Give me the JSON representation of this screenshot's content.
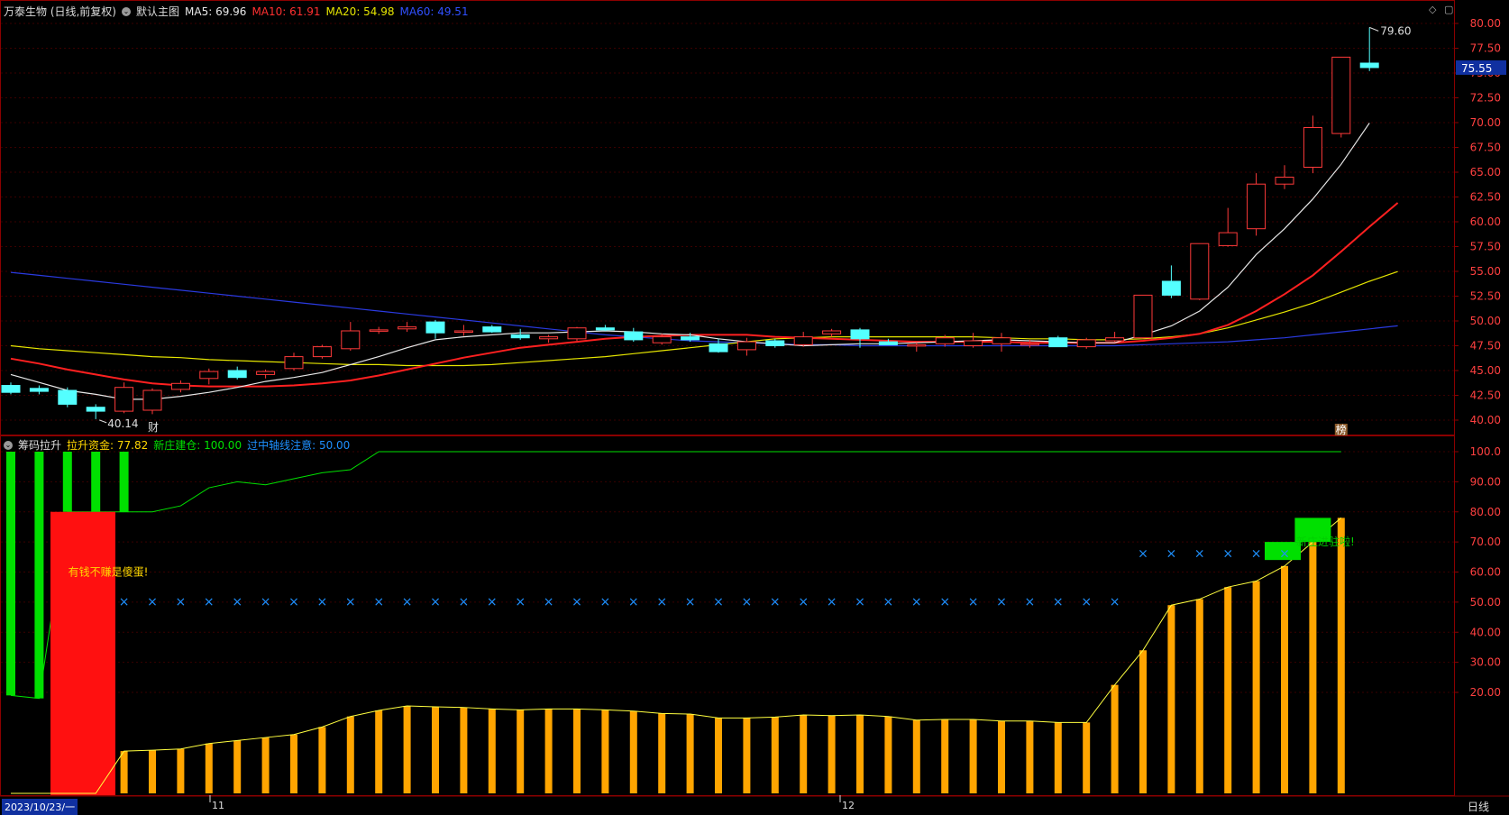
{
  "main_header": {
    "stock": "万泰生物 (日线,前复权)",
    "template": "默认主图",
    "ma5": "MA5: 69.96",
    "ma10": "MA10: 61.91",
    "ma20": "MA20: 54.98",
    "ma60": "MA60: 49.51"
  },
  "sub_header": {
    "indicator": "筹码拉升",
    "lift_fund": "拉升资金: 77.82",
    "new_dealer": "新庄建仓: 100.00",
    "midline": "过中轴线注意: 50.00"
  },
  "colors": {
    "up": "#ff3a3a",
    "down": "#54ffff",
    "ma5": "#e8e8e8",
    "ma10": "#ff2020",
    "ma20": "#e6e600",
    "ma60": "#2a3ae0",
    "frame": "#8b0000",
    "green": "#00e000",
    "orange": "#ffa500",
    "cross": "#1e90ff"
  },
  "current_price": "75.55",
  "high_label": "79.60",
  "low_label": "40.14",
  "markers": {
    "cai": "财",
    "bang": "榜"
  },
  "annotations": {
    "money": "有钱不赚是傻蛋!",
    "dealer": "新庄进驻啦!"
  },
  "price_axis": [
    "80.00",
    "77.50",
    "75.00",
    "72.50",
    "70.00",
    "67.50",
    "65.00",
    "62.50",
    "60.00",
    "57.50",
    "55.00",
    "52.50",
    "50.00",
    "47.50",
    "45.00",
    "42.50",
    "40.00"
  ],
  "sub_axis": [
    "100.0",
    "90.00",
    "80.00",
    "70.00",
    "60.00",
    "50.00",
    "40.00",
    "30.00",
    "20.00"
  ],
  "date_label": "2023/10/23/一",
  "month_labels": [
    "11",
    "12"
  ],
  "period_button": "日线",
  "chart_data": {
    "type": "candlestick",
    "ylim": [
      38.5,
      80.5
    ],
    "candles": [
      {
        "o": 43.5,
        "h": 43.8,
        "l": 42.6,
        "c": 42.8
      },
      {
        "o": 43.2,
        "h": 43.5,
        "l": 42.6,
        "c": 42.9
      },
      {
        "o": 43.0,
        "h": 43.3,
        "l": 41.3,
        "c": 41.6
      },
      {
        "o": 41.3,
        "h": 41.6,
        "l": 40.1,
        "c": 40.9
      },
      {
        "o": 40.9,
        "h": 43.8,
        "l": 40.7,
        "c": 43.3
      },
      {
        "o": 41.0,
        "h": 43.2,
        "l": 40.6,
        "c": 43.0
      },
      {
        "o": 43.1,
        "h": 44.0,
        "l": 42.8,
        "c": 43.7
      },
      {
        "o": 44.2,
        "h": 45.2,
        "l": 43.6,
        "c": 44.9
      },
      {
        "o": 45.0,
        "h": 45.4,
        "l": 44.1,
        "c": 44.3
      },
      {
        "o": 44.6,
        "h": 45.1,
        "l": 44.2,
        "c": 44.9
      },
      {
        "o": 45.2,
        "h": 46.8,
        "l": 45.0,
        "c": 46.4
      },
      {
        "o": 46.4,
        "h": 47.6,
        "l": 46.2,
        "c": 47.4
      },
      {
        "o": 47.2,
        "h": 49.9,
        "l": 47.0,
        "c": 49.0
      },
      {
        "o": 49.0,
        "h": 49.4,
        "l": 48.7,
        "c": 49.1
      },
      {
        "o": 49.2,
        "h": 49.9,
        "l": 48.9,
        "c": 49.4
      },
      {
        "o": 49.9,
        "h": 50.1,
        "l": 48.2,
        "c": 48.8
      },
      {
        "o": 48.9,
        "h": 49.6,
        "l": 48.5,
        "c": 49.0
      },
      {
        "o": 49.4,
        "h": 49.6,
        "l": 48.8,
        "c": 48.9
      },
      {
        "o": 48.6,
        "h": 49.2,
        "l": 48.1,
        "c": 48.3
      },
      {
        "o": 48.2,
        "h": 48.6,
        "l": 47.8,
        "c": 48.4
      },
      {
        "o": 48.2,
        "h": 49.4,
        "l": 48.0,
        "c": 49.3
      },
      {
        "o": 49.3,
        "h": 49.6,
        "l": 49.0,
        "c": 49.1
      },
      {
        "o": 48.9,
        "h": 49.3,
        "l": 47.9,
        "c": 48.1
      },
      {
        "o": 47.8,
        "h": 48.7,
        "l": 47.6,
        "c": 48.4
      },
      {
        "o": 48.4,
        "h": 48.8,
        "l": 47.9,
        "c": 48.1
      },
      {
        "o": 47.7,
        "h": 48.2,
        "l": 46.8,
        "c": 46.9
      },
      {
        "o": 47.1,
        "h": 48.3,
        "l": 46.5,
        "c": 47.9
      },
      {
        "o": 48.0,
        "h": 48.2,
        "l": 47.3,
        "c": 47.5
      },
      {
        "o": 47.6,
        "h": 48.9,
        "l": 47.4,
        "c": 48.4
      },
      {
        "o": 48.7,
        "h": 49.2,
        "l": 48.4,
        "c": 49.0
      },
      {
        "o": 49.1,
        "h": 49.3,
        "l": 47.3,
        "c": 48.2
      },
      {
        "o": 47.9,
        "h": 48.2,
        "l": 47.7,
        "c": 47.6
      },
      {
        "o": 47.6,
        "h": 47.8,
        "l": 46.9,
        "c": 47.6
      },
      {
        "o": 47.7,
        "h": 48.6,
        "l": 47.4,
        "c": 48.3
      },
      {
        "o": 47.5,
        "h": 48.8,
        "l": 47.3,
        "c": 48.0
      },
      {
        "o": 47.7,
        "h": 48.8,
        "l": 46.9,
        "c": 48.3
      },
      {
        "o": 47.7,
        "h": 48.1,
        "l": 47.3,
        "c": 47.7
      },
      {
        "o": 48.3,
        "h": 48.5,
        "l": 47.5,
        "c": 47.4
      },
      {
        "o": 47.4,
        "h": 48.3,
        "l": 47.2,
        "c": 48.1
      },
      {
        "o": 48.0,
        "h": 48.9,
        "l": 47.9,
        "c": 48.3
      },
      {
        "o": 48.3,
        "h": 52.6,
        "l": 48.2,
        "c": 52.6
      },
      {
        "o": 54.0,
        "h": 55.6,
        "l": 52.3,
        "c": 52.6
      },
      {
        "o": 52.2,
        "h": 57.8,
        "l": 52.1,
        "c": 57.8
      },
      {
        "o": 57.6,
        "h": 61.4,
        "l": 57.5,
        "c": 58.9
      },
      {
        "o": 59.3,
        "h": 64.9,
        "l": 58.6,
        "c": 63.8
      },
      {
        "o": 63.8,
        "h": 65.7,
        "l": 63.3,
        "c": 64.5
      },
      {
        "o": 65.5,
        "h": 70.7,
        "l": 64.9,
        "c": 69.5
      },
      {
        "o": 68.9,
        "h": 76.6,
        "l": 68.5,
        "c": 76.6
      },
      {
        "o": 76.0,
        "h": 79.6,
        "l": 75.2,
        "c": 75.55
      }
    ],
    "ma5": [
      44.6,
      43.8,
      43.0,
      42.6,
      42.1,
      42.1,
      42.4,
      42.8,
      43.3,
      43.9,
      44.3,
      44.8,
      45.6,
      46.4,
      47.3,
      48.1,
      48.4,
      48.6,
      48.8,
      48.8,
      48.9,
      49.0,
      48.9,
      48.7,
      48.6,
      48.2,
      47.9,
      47.7,
      47.5,
      47.6,
      47.7,
      47.7,
      47.8,
      47.9,
      48.0,
      48.1,
      48.0,
      47.9,
      47.8,
      47.8,
      48.6,
      49.5,
      51.0,
      53.4,
      56.7,
      59.3,
      62.3,
      65.8,
      69.96
    ],
    "ma10": [
      46.2,
      45.7,
      45.1,
      44.6,
      44.1,
      43.7,
      43.5,
      43.4,
      43.4,
      43.4,
      43.5,
      43.7,
      44.0,
      44.5,
      45.1,
      45.7,
      46.3,
      46.8,
      47.3,
      47.6,
      47.9,
      48.2,
      48.4,
      48.5,
      48.6,
      48.6,
      48.6,
      48.4,
      48.3,
      48.2,
      48.1,
      48.0,
      47.9,
      47.9,
      47.9,
      47.9,
      47.8,
      47.8,
      47.8,
      47.8,
      48.0,
      48.3,
      48.7,
      49.6,
      51.0,
      52.7,
      54.6,
      57.0,
      59.5,
      61.91
    ],
    "ma20": [
      47.5,
      47.2,
      47.0,
      46.8,
      46.6,
      46.4,
      46.3,
      46.1,
      46.0,
      45.9,
      45.8,
      45.7,
      45.6,
      45.6,
      45.5,
      45.5,
      45.5,
      45.6,
      45.8,
      46.0,
      46.2,
      46.4,
      46.7,
      47.0,
      47.3,
      47.6,
      47.9,
      48.2,
      48.3,
      48.4,
      48.4,
      48.4,
      48.4,
      48.4,
      48.4,
      48.3,
      48.2,
      48.2,
      48.1,
      48.1,
      48.2,
      48.4,
      48.7,
      49.3,
      50.1,
      50.9,
      51.8,
      52.9,
      54.0,
      54.98
    ],
    "ma60": [
      54.9,
      54.6,
      54.3,
      54.0,
      53.7,
      53.4,
      53.1,
      52.8,
      52.5,
      52.2,
      51.9,
      51.6,
      51.3,
      51.0,
      50.7,
      50.4,
      50.1,
      49.8,
      49.5,
      49.2,
      48.9,
      48.6,
      48.4,
      48.2,
      48.0,
      47.9,
      47.8,
      47.7,
      47.6,
      47.6,
      47.5,
      47.5,
      47.5,
      47.5,
      47.5,
      47.5,
      47.5,
      47.5,
      47.5,
      47.5,
      47.6,
      47.7,
      47.8,
      47.9,
      48.1,
      48.3,
      48.6,
      48.9,
      49.2,
      49.51
    ],
    "sub": {
      "ylim": [
        0,
        103
      ],
      "green_top": [
        100,
        100,
        100,
        100,
        100,
        80,
        82,
        88,
        90,
        89,
        91,
        93,
        94,
        100,
        100,
        100,
        100,
        100,
        100,
        100,
        100,
        100,
        100,
        100,
        100,
        93,
        94,
        94,
        100,
        100,
        94,
        93,
        94,
        100,
        100,
        93,
        94,
        94,
        100,
        100,
        100,
        100,
        100,
        100,
        100,
        100,
        100,
        100
      ],
      "green_bottom": [
        19,
        18,
        80,
        80,
        80,
        80,
        82,
        88,
        90,
        89,
        91,
        93,
        94,
        100,
        100,
        100,
        100,
        100,
        100,
        100,
        100,
        100,
        100,
        100,
        100,
        100,
        100,
        100,
        100,
        100,
        100,
        100,
        100,
        100,
        100,
        100,
        100,
        100,
        100,
        100,
        100,
        100,
        100,
        100,
        100,
        100,
        100,
        100
      ],
      "orange": [
        0,
        0,
        0,
        0,
        0.5,
        0.8,
        1.2,
        3,
        4,
        5,
        6,
        8.5,
        12,
        14,
        15.5,
        15.2,
        15,
        14.5,
        14.2,
        14.5,
        14.5,
        14.2,
        13.8,
        13,
        12.8,
        11.5,
        11.5,
        11.8,
        12.5,
        12.3,
        12.5,
        12,
        10.8,
        11,
        11,
        10.5,
        10.5,
        10,
        10,
        22.5,
        34,
        49,
        51,
        55,
        57,
        62,
        70,
        78
      ],
      "crosses": [
        null,
        null,
        null,
        null,
        50,
        50,
        50,
        50,
        50,
        50,
        50,
        50,
        50,
        50,
        50,
        50,
        50,
        50,
        50,
        50,
        50,
        50,
        50,
        50,
        50,
        50,
        50,
        50,
        50,
        50,
        50,
        50,
        50,
        50,
        50,
        50,
        50,
        50,
        50,
        50,
        66,
        66,
        66,
        66,
        66,
        66,
        null,
        null
      ]
    }
  }
}
